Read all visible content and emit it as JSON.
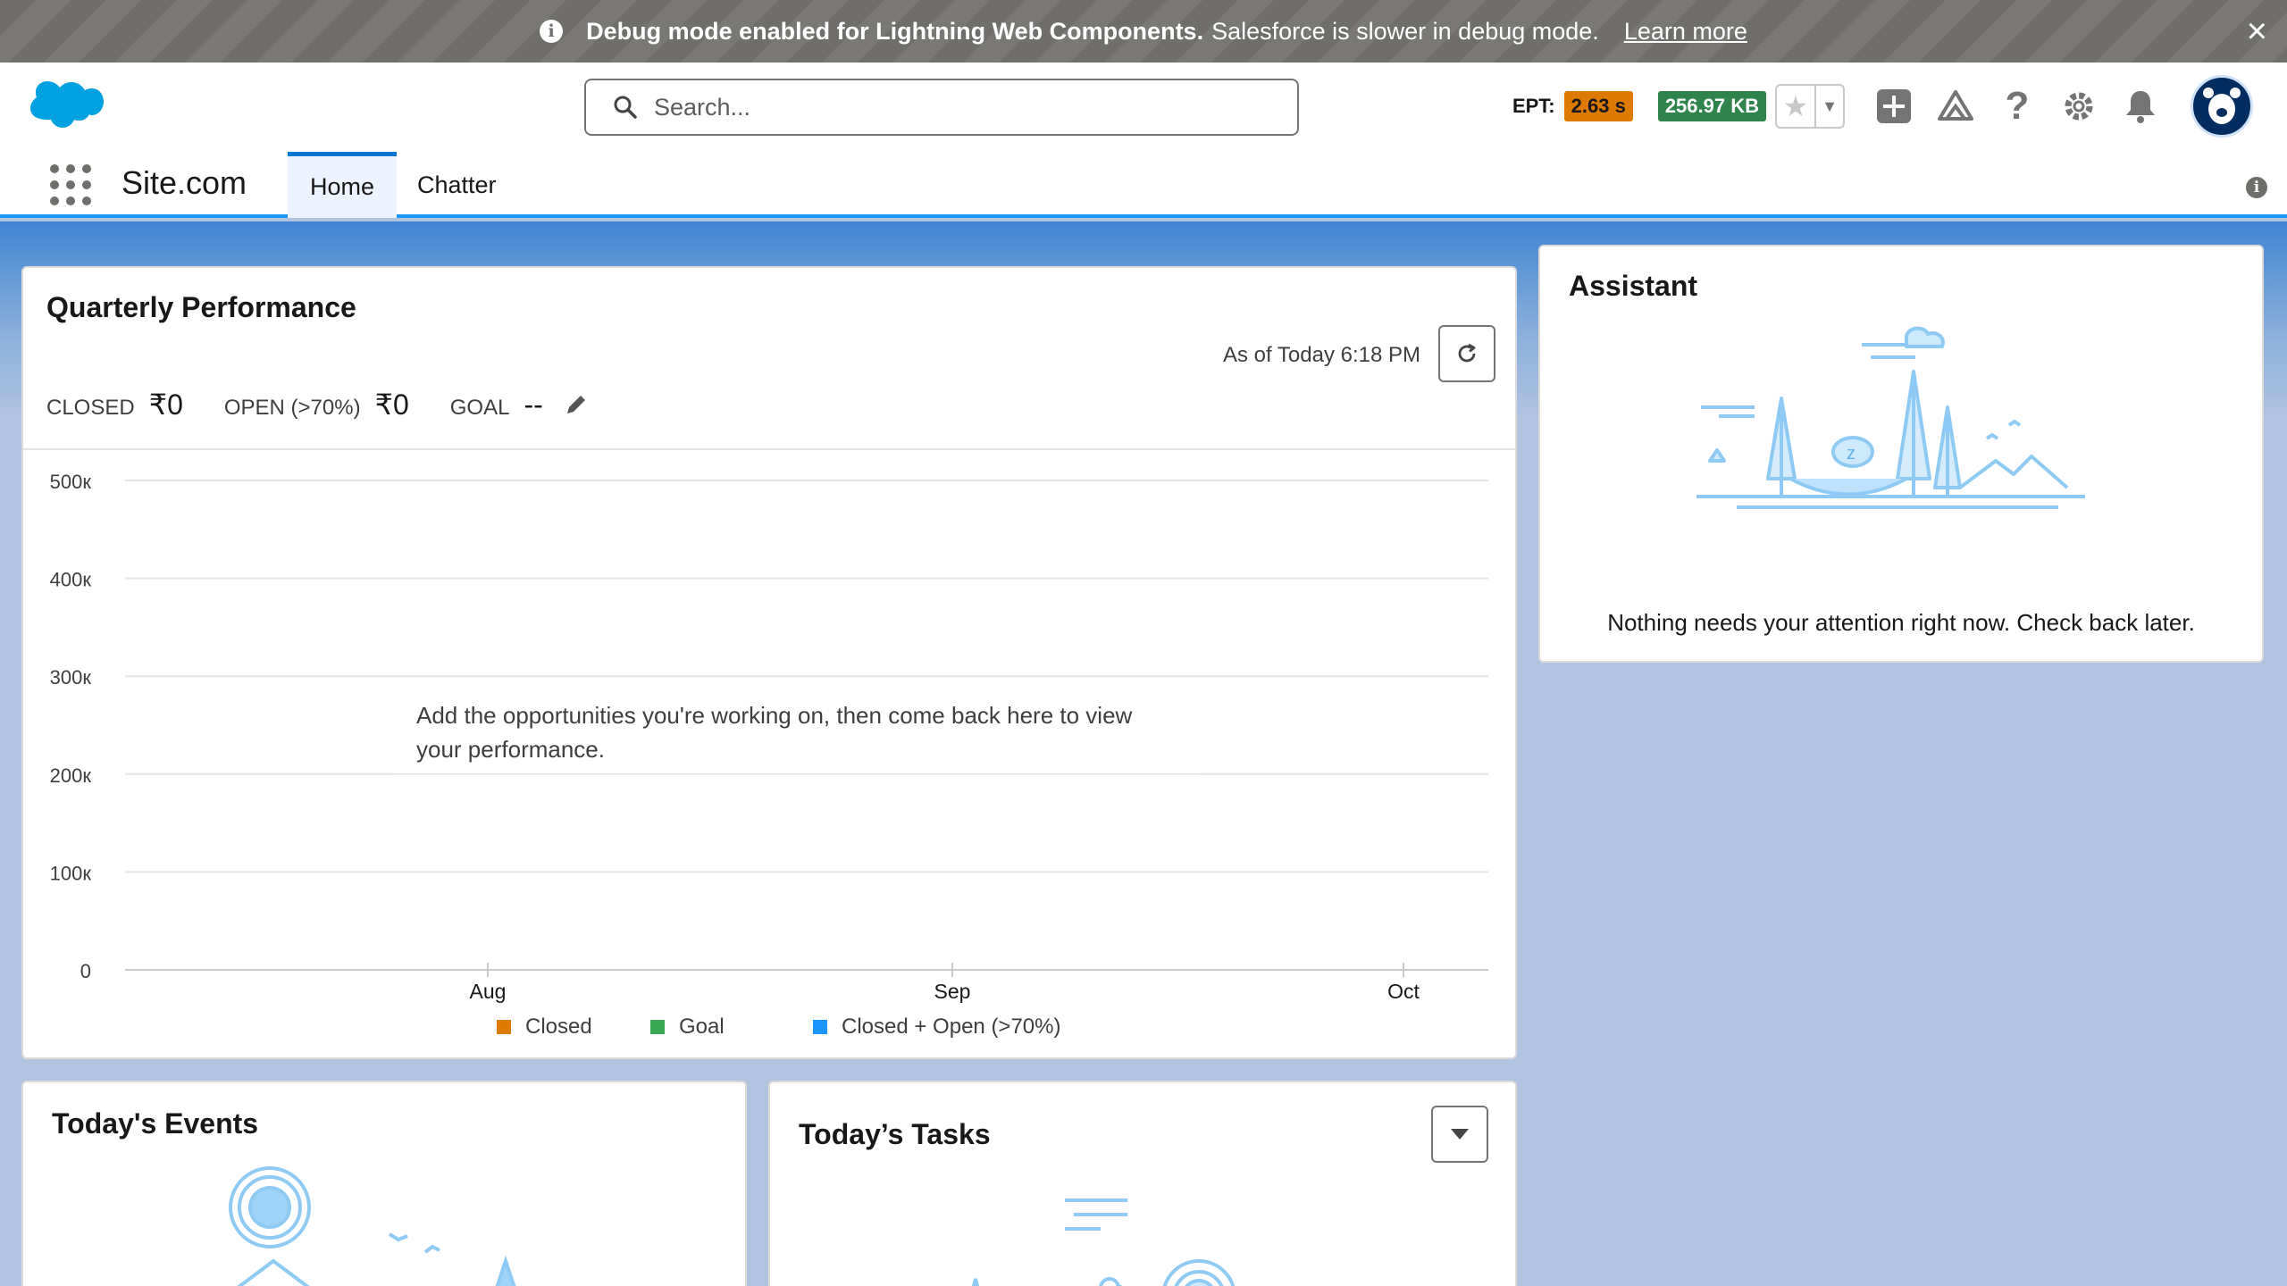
{
  "banner": {
    "bold_text": "Debug mode enabled for Lightning Web Components.",
    "text": "Salesforce is slower in debug mode.",
    "link": "Learn more",
    "close_icon": "close-icon"
  },
  "header": {
    "search_placeholder": "Search...",
    "ept_label": "EPT:",
    "ept_value": "2.63 s",
    "kb_value": "256.97 KB",
    "icons": [
      "star-icon",
      "chevron-down-icon",
      "add-icon",
      "trailhead-icon",
      "help-icon",
      "gear-icon",
      "bell-icon",
      "avatar"
    ]
  },
  "nav": {
    "app_name": "Site.com",
    "tabs": [
      {
        "label": "Home",
        "active": true
      },
      {
        "label": "Chatter",
        "active": false
      }
    ]
  },
  "quarterly": {
    "title": "Quarterly Performance",
    "as_of": "As of Today 6:18 PM",
    "closed_label": "CLOSED",
    "closed_value": "₹0",
    "open_label": "OPEN (>70%)",
    "open_value": "₹0",
    "goal_label": "GOAL",
    "goal_value": "--",
    "empty_message": "Add the opportunities you're working on, then come back here to view your performance."
  },
  "chart_data": {
    "type": "line",
    "categories": [
      "Aug",
      "Sep",
      "Oct"
    ],
    "y_ticks": [
      "500к",
      "400к",
      "300к",
      "200к",
      "100к",
      "0"
    ],
    "ylim": [
      0,
      500000
    ],
    "series": [
      {
        "name": "Closed",
        "values": [],
        "color": "#dd7a01"
      },
      {
        "name": "Goal",
        "values": [],
        "color": "#3ba755"
      },
      {
        "name": "Closed + Open (>70%)",
        "values": [],
        "color": "#1b96ff"
      }
    ],
    "grid": true,
    "legend": "bottom"
  },
  "assistant": {
    "title": "Assistant",
    "message": "Nothing needs your attention right now. Check back later."
  },
  "events": {
    "title": "Today's Events"
  },
  "tasks": {
    "title": "Today’s Tasks"
  }
}
